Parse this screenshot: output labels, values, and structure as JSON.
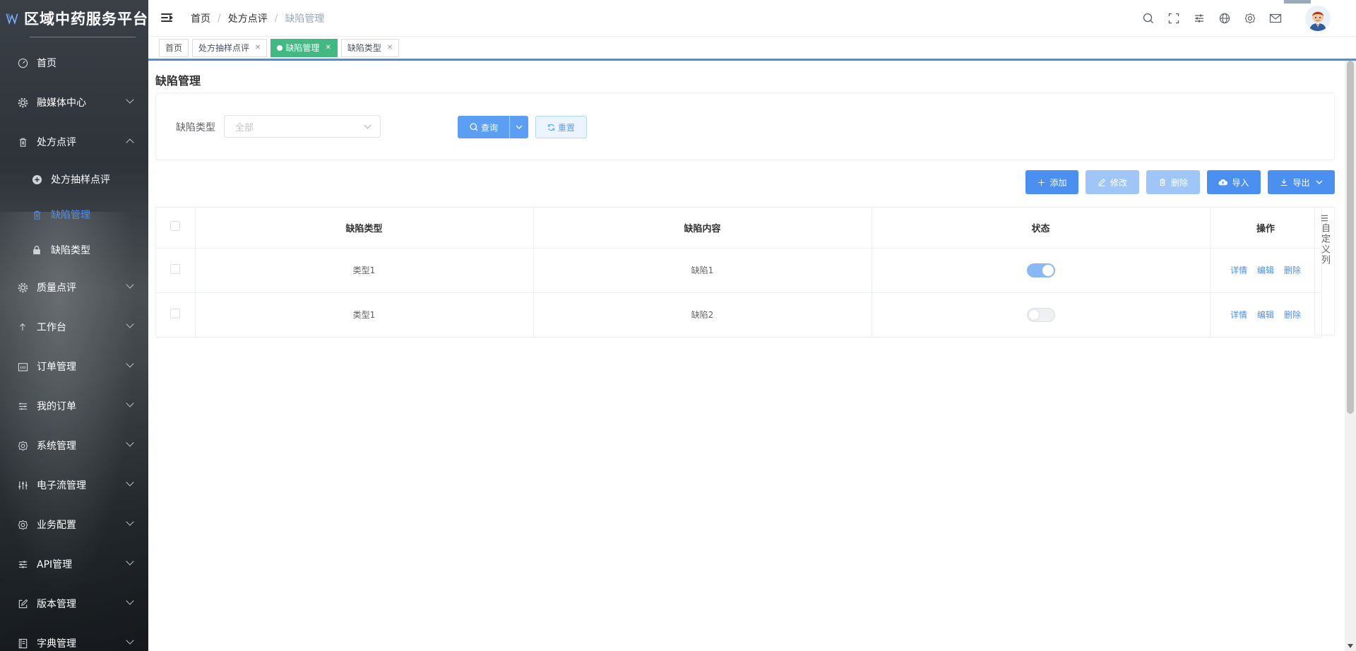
{
  "app": {
    "title": "区域中药服务平台"
  },
  "sidebar": {
    "items": [
      {
        "label": "首页",
        "icon": "dashboard-icon"
      },
      {
        "label": "融媒体中心",
        "icon": "gear-icon"
      },
      {
        "label": "处方点评",
        "icon": "trash-icon"
      },
      {
        "label": "质量点评",
        "icon": "gear-icon"
      },
      {
        "label": "工作台",
        "icon": "arrow-up-icon"
      },
      {
        "label": "订单管理",
        "icon": "calendar-icon"
      },
      {
        "label": "我的订单",
        "icon": "list-icon"
      },
      {
        "label": "系统管理",
        "icon": "settings-icon"
      },
      {
        "label": "电子流管理",
        "icon": "sliders-icon"
      },
      {
        "label": "业务配置",
        "icon": "settings-icon"
      },
      {
        "label": "API管理",
        "icon": "sliders-icon"
      },
      {
        "label": "版本管理",
        "icon": "edit-icon"
      },
      {
        "label": "字典管理",
        "icon": "book-icon"
      }
    ],
    "sub_items": [
      {
        "label": "处方抽样点评",
        "icon": "plus-circle-icon"
      },
      {
        "label": "缺陷管理",
        "icon": "trash-icon"
      },
      {
        "label": "缺陷类型",
        "icon": "lock-icon"
      }
    ]
  },
  "topbar": {
    "breadcrumb": [
      "首页",
      "处方点评",
      "缺陷管理"
    ],
    "icons": [
      "search-icon",
      "fullscreen-icon",
      "sliders-icon",
      "globe-icon",
      "settings-icon",
      "mail-icon"
    ]
  },
  "tags": [
    {
      "label": "首页",
      "closable": false,
      "active": false
    },
    {
      "label": "处方抽样点评",
      "closable": true,
      "active": false
    },
    {
      "label": "缺陷管理",
      "closable": true,
      "active": true
    },
    {
      "label": "缺陷类型",
      "closable": true,
      "active": false
    }
  ],
  "page": {
    "title": "缺陷管理",
    "filter": {
      "label": "缺陷类型",
      "placeholder": "全部",
      "query_label": "查询",
      "reset_label": "重置"
    },
    "toolbar": {
      "add": "添加",
      "edit": "修改",
      "delete": "删除",
      "import": "导入",
      "export": "导出"
    },
    "table": {
      "columns": [
        "缺陷类型",
        "缺陷内容",
        "状态",
        "操作"
      ],
      "rows": [
        {
          "type": "类型1",
          "content": "缺陷1",
          "status_on": true
        },
        {
          "type": "类型1",
          "content": "缺陷2",
          "status_on": false
        }
      ],
      "actions": [
        "详情",
        "编辑",
        "删除"
      ],
      "custom_column_label": "自定义列"
    }
  },
  "colors": {
    "primary": "#4b8ff0",
    "tag_active": "#42b983",
    "menu_active": "#4d8df0"
  }
}
